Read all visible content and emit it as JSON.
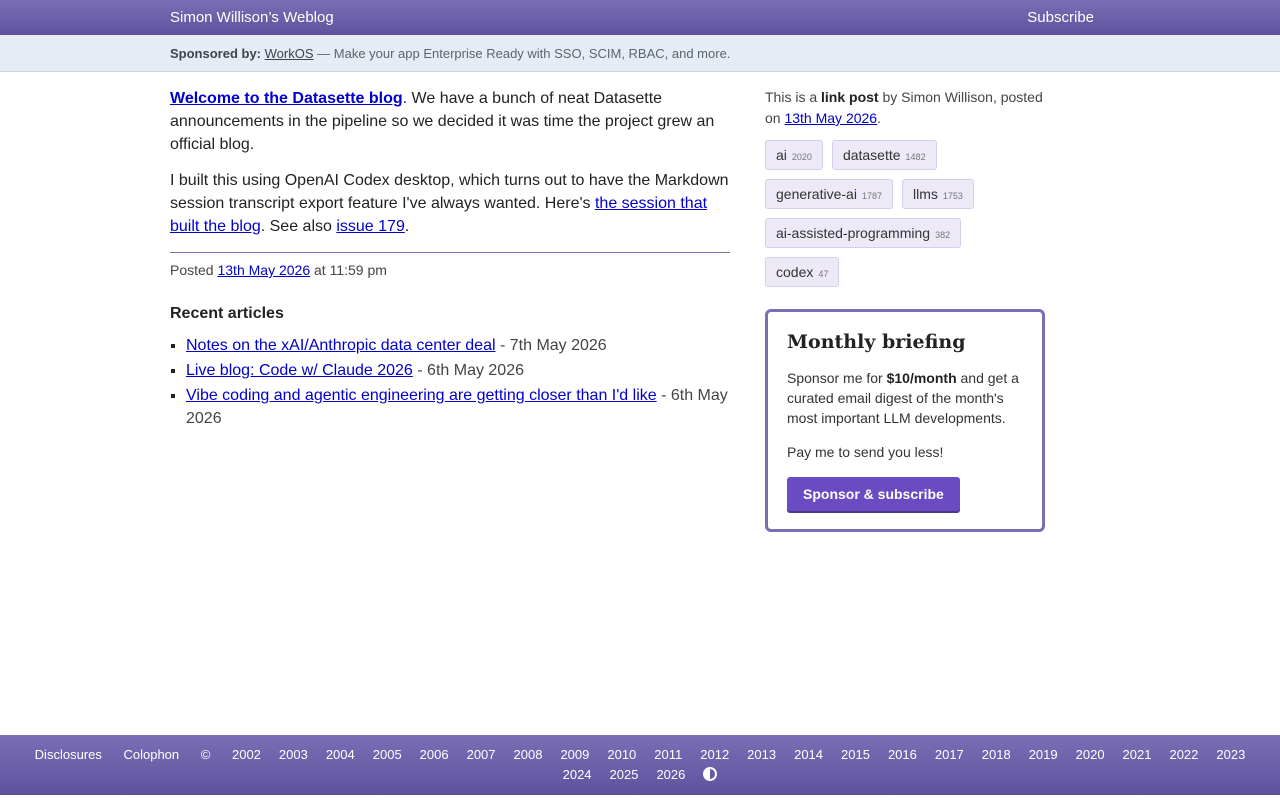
{
  "header": {
    "site_title": "Simon Willison’s Weblog",
    "subscribe": "Subscribe"
  },
  "sponsor": {
    "label": "Sponsored by:",
    "sponsor_name": "WorkOS",
    "text": " — Make your app Enterprise Ready with SSO, SCIM, RBAC, and more."
  },
  "post": {
    "p1_link": "Welcome to the Datasette blog",
    "p1_text": ". We have a bunch of neat Datasette announcements in the pipeline so we decided it was time the project grew an official blog.",
    "p2_text_a": "I built this using OpenAI Codex desktop, which turns out to have the Markdown session transcript export feature I've always wanted. Here's ",
    "p2_link_a": "the session that built the blog",
    "p2_text_b": ". See also ",
    "p2_link_b": "issue 179",
    "p2_text_c": ".",
    "posted_label": "Posted ",
    "posted_date": "13th May 2026",
    "posted_time": " at 11:59 pm"
  },
  "recent": {
    "heading": "Recent articles",
    "items": [
      {
        "title": "Notes on the xAI/Anthropic data center deal",
        "date": " - 7th May 2026"
      },
      {
        "title": "Live blog: Code w/ Claude 2026",
        "date": " - 6th May 2026"
      },
      {
        "title": "Vibe coding and agentic engineering are getting closer than I'd like",
        "date": " - 6th May 2026"
      }
    ]
  },
  "sidebar": {
    "meta_a": "This is a ",
    "meta_b": "link post",
    "meta_c": " by Simon Willison, posted on ",
    "meta_date": "13th May 2026",
    "meta_d": ".",
    "tags": [
      {
        "name": "ai",
        "count": "2020"
      },
      {
        "name": "datasette",
        "count": "1482"
      },
      {
        "name": "generative-ai",
        "count": "1787"
      },
      {
        "name": "llms",
        "count": "1753"
      },
      {
        "name": "ai-assisted-programming",
        "count": "382"
      },
      {
        "name": "codex",
        "count": "47"
      }
    ]
  },
  "briefing": {
    "title": "Monthly briefing",
    "desc_a": "Sponsor me for ",
    "desc_b": "$10/month",
    "desc_c": " and get a curated email digest of the month's most important LLM developments.",
    "pay": "Pay me to send you less!",
    "cta": "Sponsor & subscribe"
  },
  "footer": {
    "disclosures": "Disclosures",
    "colophon": "Colophon",
    "copyright": "©",
    "years_row1": [
      "2002",
      "2003",
      "2004",
      "2005",
      "2006",
      "2007",
      "2008",
      "2009",
      "2010",
      "2011",
      "2012",
      "2013",
      "2014",
      "2015",
      "2016",
      "2017",
      "2018",
      "2019",
      "2020",
      "2021",
      "2022",
      "2023"
    ],
    "years_row2": [
      "2024",
      "2025",
      "2026"
    ],
    "theme_icon": "contrast-icon"
  },
  "colors": {
    "header_accent": "#7a6fb5",
    "link": "#0000cc",
    "cta": "#6a4bc2",
    "tag_bg": "#ede9f7"
  }
}
